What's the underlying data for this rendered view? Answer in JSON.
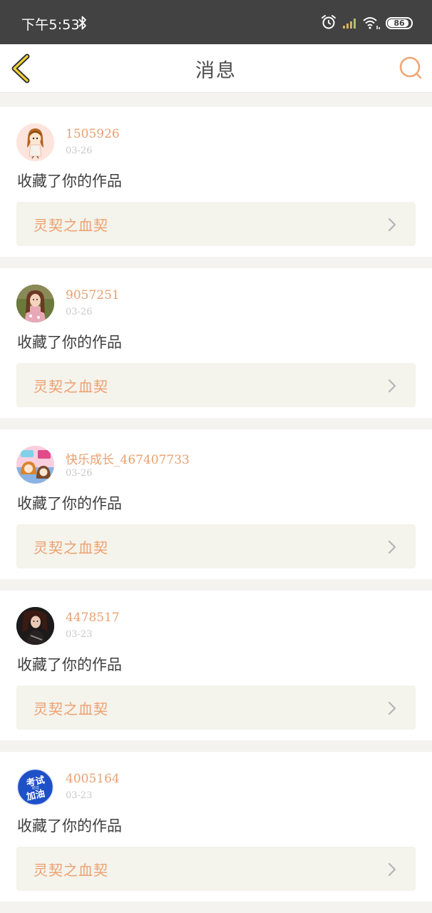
{
  "status_bar": {
    "time": "下午5:53",
    "battery": "86"
  },
  "header": {
    "title": "消息"
  },
  "colors": {
    "accent": "#eda16f",
    "username": "#e8a070",
    "status_bar_bg": "#424242",
    "link_bg": "#f4f3ec"
  },
  "messages": [
    {
      "username": "1505926",
      "date": "03-26",
      "text": "收藏了你的作品",
      "work": "灵契之血契",
      "avatar": "cartoon-girl-avatar"
    },
    {
      "username": "9057251",
      "date": "03-26",
      "text": "收藏了你的作品",
      "work": "灵契之血契",
      "avatar": "photo-girl-avatar"
    },
    {
      "username": "快乐成长_467407733",
      "date": "03-26",
      "text": "收藏了你的作品",
      "work": "灵契之血契",
      "avatar": "anime-collage-avatar"
    },
    {
      "username": "4478517",
      "date": "03-23",
      "text": "收藏了你的作品",
      "work": "灵契之血契",
      "avatar": "dark-character-avatar"
    },
    {
      "username": "4005164",
      "date": "03-23",
      "text": "收藏了你的作品",
      "work": "灵契之血契",
      "avatar": "exam-badge-avatar",
      "avatar_text": {
        "line1": "考试",
        "line2": "加油",
        "small": "必过"
      }
    }
  ]
}
